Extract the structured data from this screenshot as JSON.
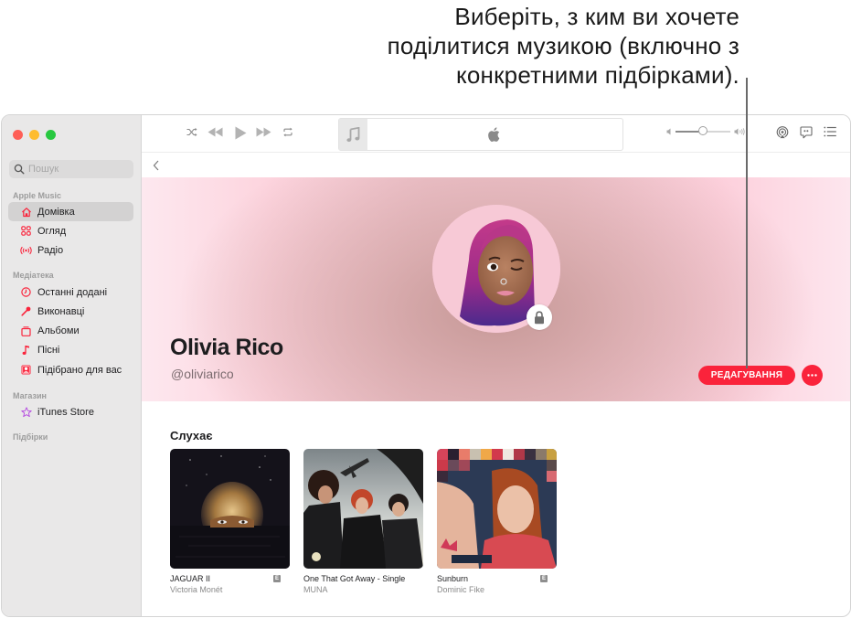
{
  "callout": {
    "lines": [
      "Виберіть, з ким ви хочете",
      "поділитися музикою (включно з",
      "конкретними підбірками)."
    ]
  },
  "window": {
    "traffic_lights": [
      "close",
      "minimize",
      "zoom"
    ],
    "sidebar": {
      "search": {
        "placeholder": "Пошук",
        "value": ""
      },
      "sections": [
        {
          "label": "Apple Music",
          "items": [
            {
              "label": "Домівка",
              "icon": "house-icon",
              "active": true
            },
            {
              "label": "Огляд",
              "icon": "grid-icon",
              "active": false
            },
            {
              "label": "Радіо",
              "icon": "radio-waves-icon",
              "active": false
            }
          ]
        },
        {
          "label": "Медіатека",
          "items": [
            {
              "label": "Останні додані",
              "icon": "clock-icon",
              "active": false
            },
            {
              "label": "Виконавці",
              "icon": "microphone-icon",
              "active": false
            },
            {
              "label": "Альбоми",
              "icon": "album-stack-icon",
              "active": false
            },
            {
              "label": "Пісні",
              "icon": "music-note-icon",
              "active": false
            },
            {
              "label": "Підібрано для вас",
              "icon": "person-square-icon",
              "active": false
            }
          ]
        },
        {
          "label": "Магазин",
          "items": [
            {
              "label": "iTunes Store",
              "icon": "star-icon",
              "active": false
            }
          ]
        },
        {
          "label": "Підбірки",
          "items": []
        }
      ]
    },
    "toolbar": {
      "controls": [
        "shuffle-icon",
        "rewind-icon",
        "play-icon",
        "fast-forward-icon",
        "repeat-icon"
      ],
      "lcd": {
        "artwork_icon": "music-note-icon",
        "center_icon": "apple-logo-icon"
      },
      "volume_level": 0.5,
      "right_icons": [
        "airplay-icon",
        "lyrics-icon",
        "queue-list-icon"
      ]
    },
    "profile": {
      "name": "Olivia Rico",
      "handle": "@oliviarico",
      "edit_label": "РЕДАГУВАННЯ",
      "more_label": "•••",
      "locked": true,
      "colors": {
        "accent": "#fa233b"
      }
    },
    "listening": {
      "title": "Слухає",
      "albums": [
        {
          "title": "JAGUAR II",
          "artist": "Victoria Monét",
          "explicit": true,
          "explicit_label": "E"
        },
        {
          "title": "One That Got Away - Single",
          "artist": "MUNA",
          "explicit": false,
          "explicit_label": ""
        },
        {
          "title": "Sunburn",
          "artist": "Dominic Fike",
          "explicit": true,
          "explicit_label": "E"
        }
      ]
    }
  }
}
